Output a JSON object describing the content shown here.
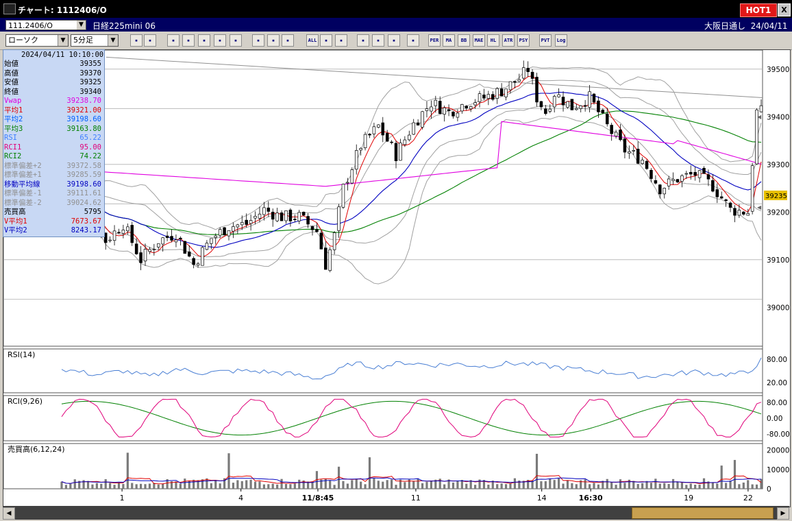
{
  "window": {
    "title": "チャート: 1112406/O",
    "hot_label": "HOT1",
    "close_label": "X"
  },
  "infobar": {
    "code": "111.2406/O",
    "instrument": "日経225mini 06",
    "session": "大阪日通し",
    "date": "24/04/11"
  },
  "toolbar": {
    "chart_type": "ローソク",
    "interval": "5分足",
    "buttons": [
      "zoom",
      "split",
      "candle-style",
      "bb-style",
      "stats",
      "custom1",
      "custom2",
      "disabled",
      "candle",
      "ohlc",
      "all",
      "draw",
      "cursor",
      "pointer",
      "eraser",
      "settings",
      "paint",
      "PER",
      "MA",
      "BB",
      "MAE",
      "HL",
      "ATR",
      "PSY",
      "PVT",
      "Log",
      "export"
    ],
    "button_labels": {
      "PER": "PER",
      "MA": "MA",
      "BB": "BB",
      "MAE": "MAE",
      "HL": "HL",
      "ATR": "ATR",
      "PSY": "PSY",
      "PVT": "PVT",
      "Log": "Log",
      "all": "ALL"
    }
  },
  "info_panel": {
    "timestamp": "2024/04/11  10:10:00",
    "rows": [
      {
        "label": "始値",
        "value": "39355",
        "color": "#000000"
      },
      {
        "label": "高値",
        "value": "39370",
        "color": "#000000"
      },
      {
        "label": "安値",
        "value": "39325",
        "color": "#000000"
      },
      {
        "label": "終値",
        "value": "39340",
        "color": "#000000"
      },
      {
        "label": "Vwap",
        "value": "39238.70",
        "color": "#e000e0"
      },
      {
        "label": "平均1",
        "value": "39321.00",
        "color": "#e00000"
      },
      {
        "label": "平均2",
        "value": "39198.60",
        "color": "#0060ff"
      },
      {
        "label": "平均3",
        "value": "39163.80",
        "color": "#008000"
      },
      {
        "label": "RSI",
        "value": "65.22",
        "color": "#4080ff"
      },
      {
        "label": "RCI1",
        "value": "95.00",
        "color": "#e0007a"
      },
      {
        "label": "RCI2",
        "value": "74.22",
        "color": "#008000"
      },
      {
        "label": "標準偏差+2",
        "value": "39372.58",
        "color": "#909090"
      },
      {
        "label": "標準偏差+1",
        "value": "39285.59",
        "color": "#909090"
      },
      {
        "label": "移動平均線",
        "value": "39198.60",
        "color": "#0000c0"
      },
      {
        "label": "標準偏差-1",
        "value": "39111.61",
        "color": "#909090"
      },
      {
        "label": "標準偏差-2",
        "value": "39024.62",
        "color": "#909090"
      },
      {
        "label": "売買高",
        "value": "5795",
        "color": "#000000"
      },
      {
        "label": "V平均1",
        "value": "7673.67",
        "color": "#e00000"
      },
      {
        "label": "V平均2",
        "value": "8243.17",
        "color": "#0000c0"
      }
    ]
  },
  "chart_data": [
    {
      "type": "candlestick",
      "title": "",
      "ylim": [
        38930,
        39540
      ],
      "y_ticks": [
        39000,
        39100,
        39200,
        39300,
        39400,
        39500
      ],
      "y_tick_labels": [
        "39000",
        "39100",
        "39200",
        "39300",
        "39400",
        "39500"
      ],
      "current_price_label": "39235",
      "dashed_level": 39550,
      "x_tick_labels": [
        "1",
        "4",
        "11/8:45",
        "11",
        "14",
        "16:30",
        "19",
        "22"
      ],
      "n_bars": 160,
      "close_path": [
        [
          0,
          39240
        ],
        [
          6,
          39205
        ],
        [
          10,
          39140
        ],
        [
          14,
          39175
        ],
        [
          18,
          39100
        ],
        [
          22,
          39140
        ],
        [
          26,
          39155
        ],
        [
          30,
          39090
        ],
        [
          34,
          39145
        ],
        [
          38,
          39170
        ],
        [
          42,
          39175
        ],
        [
          46,
          39205
        ],
        [
          50,
          39190
        ],
        [
          54,
          39190
        ],
        [
          58,
          39160
        ],
        [
          60,
          39090
        ],
        [
          62,
          39150
        ],
        [
          64,
          39250
        ],
        [
          68,
          39340
        ],
        [
          72,
          39380
        ],
        [
          76,
          39320
        ],
        [
          80,
          39385
        ],
        [
          84,
          39430
        ],
        [
          88,
          39410
        ],
        [
          92,
          39430
        ],
        [
          96,
          39440
        ],
        [
          100,
          39455
        ],
        [
          104,
          39480
        ],
        [
          106,
          39500
        ],
        [
          108,
          39440
        ],
        [
          110,
          39410
        ],
        [
          112,
          39450
        ],
        [
          116,
          39420
        ],
        [
          120,
          39440
        ],
        [
          124,
          39380
        ],
        [
          128,
          39330
        ],
        [
          132,
          39310
        ],
        [
          136,
          39250
        ],
        [
          140,
          39270
        ],
        [
          144,
          39280
        ],
        [
          148,
          39255
        ],
        [
          152,
          39205
        ],
        [
          156,
          39200
        ],
        [
          158,
          39410
        ],
        [
          159,
          39410
        ]
      ],
      "ma1_label": "平均1",
      "ma2_label": "平均2",
      "ma3_label": "平均3",
      "vwap_label": "Vwap"
    },
    {
      "type": "line",
      "title": "RSI(14)",
      "ylim": [
        0,
        100
      ],
      "y_tick_labels": [
        "80.00",
        "20.00"
      ],
      "y_ticks": [
        80,
        20
      ],
      "series": [
        {
          "name": "RSI",
          "values_path": [
            [
              0,
              55
            ],
            [
              8,
              40
            ],
            [
              14,
              50
            ],
            [
              20,
              35
            ],
            [
              26,
              55
            ],
            [
              32,
              45
            ],
            [
              40,
              50
            ],
            [
              46,
              48
            ],
            [
              52,
              42
            ],
            [
              58,
              30
            ],
            [
              62,
              45
            ],
            [
              66,
              70
            ],
            [
              72,
              60
            ],
            [
              78,
              72
            ],
            [
              84,
              65
            ],
            [
              90,
              68
            ],
            [
              96,
              62
            ],
            [
              102,
              70
            ],
            [
              108,
              66
            ],
            [
              114,
              58
            ],
            [
              120,
              50
            ],
            [
              126,
              45
            ],
            [
              132,
              35
            ],
            [
              138,
              40
            ],
            [
              144,
              48
            ],
            [
              150,
              40
            ],
            [
              156,
              45
            ],
            [
              159,
              78
            ]
          ]
        }
      ]
    },
    {
      "type": "line",
      "title": "RCI(9,26)",
      "ylim": [
        -100,
        100
      ],
      "y_tick_labels": [
        "80.00",
        "0.00",
        "-80.00"
      ],
      "y_ticks": [
        80,
        0,
        -80
      ],
      "series": [
        {
          "name": "RCI1",
          "color": "#e0007a"
        },
        {
          "name": "RCI2",
          "color": "#008000"
        }
      ]
    },
    {
      "type": "bar",
      "title": "売買高(6,12,24)",
      "ylim": [
        0,
        22000
      ],
      "y_tick_labels": [
        "20000",
        "10000",
        "0"
      ],
      "y_ticks": [
        20000,
        10000,
        0
      ]
    }
  ]
}
